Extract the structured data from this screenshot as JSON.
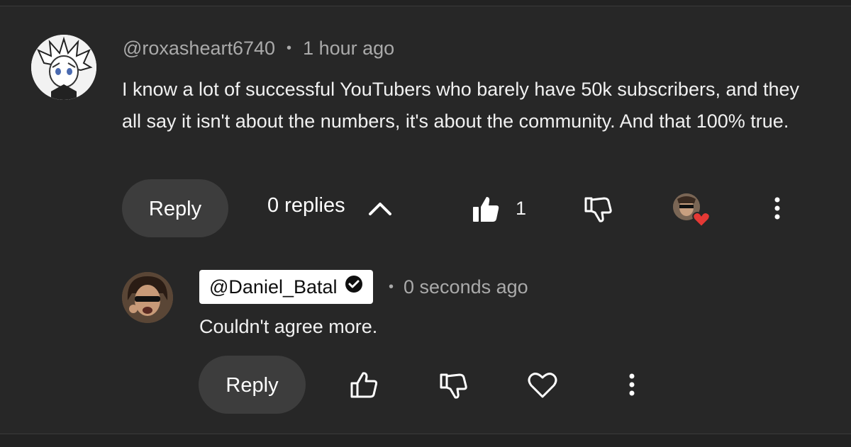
{
  "comment": {
    "author": "@roxasheart6740",
    "time": "1 hour ago",
    "text": "I know a lot of successful YouTubers who barely have 50k subscribers, and they all say it isn't about the numbers, it's about the community. And that 100% true.",
    "reply_label": "Reply",
    "replies_label": "0 replies",
    "like_count": "1",
    "icons": [
      "thumbs-up-filled-icon",
      "thumbs-down-icon",
      "creator-heart-icon",
      "more-vert-icon",
      "chevron-up-icon"
    ]
  },
  "reply": {
    "author": "@Daniel_Batal",
    "time": "0 seconds ago",
    "text": "Couldn't agree more.",
    "reply_label": "Reply",
    "icons": [
      "verified-check-icon",
      "thumbs-up-icon",
      "thumbs-down-icon",
      "heart-icon",
      "more-vert-icon"
    ]
  },
  "colors": {
    "background": "#272727",
    "pill": "#3d3d3d",
    "secondary_text": "#aaaaaa",
    "heart": "#e53935"
  }
}
